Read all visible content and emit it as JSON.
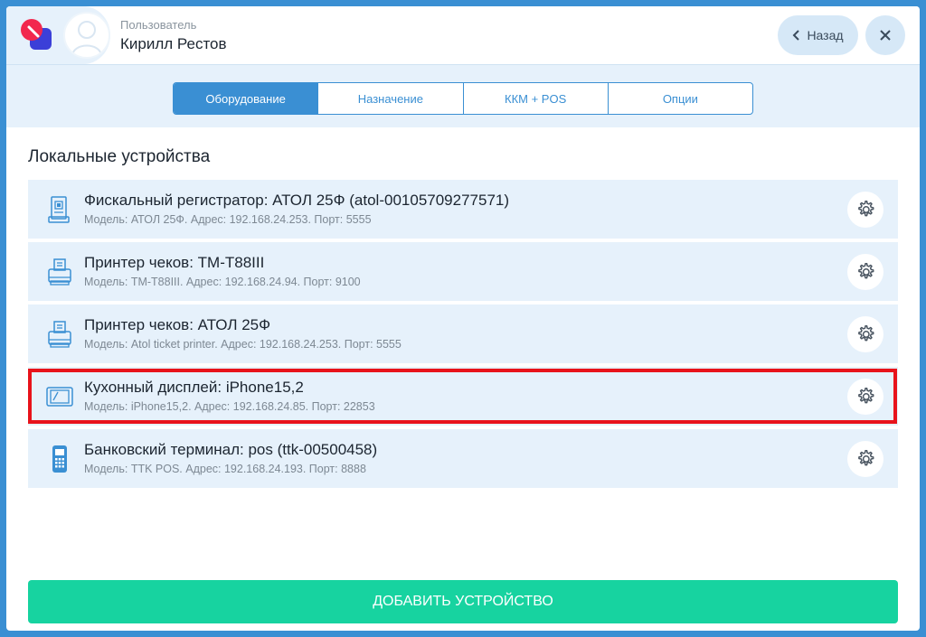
{
  "header": {
    "user_caption": "Пользователь",
    "user_name": "Кирилл Рестов",
    "back_label": "Назад"
  },
  "tabs": [
    {
      "label": "Оборудование",
      "active": true
    },
    {
      "label": "Назначение",
      "active": false
    },
    {
      "label": "ККМ + POS",
      "active": false
    },
    {
      "label": "Опции",
      "active": false
    }
  ],
  "section_title": "Локальные устройства",
  "devices": [
    {
      "icon": "fiscal-register-icon",
      "name": "Фискальный регистратор: АТОЛ 25Ф (atol-00105709277571)",
      "details": "Модель: АТОЛ 25Ф. Адрес: 192.168.24.253. Порт: 5555"
    },
    {
      "icon": "receipt-printer-icon",
      "name": "Принтер чеков: TM-T88III",
      "details": "Модель: TM-T88III. Адрес: 192.168.24.94. Порт: 9100"
    },
    {
      "icon": "receipt-printer-icon",
      "name": "Принтер чеков: АТОЛ 25Ф",
      "details": "Модель: Atol ticket printer. Адрес: 192.168.24.253. Порт: 5555"
    },
    {
      "icon": "tablet-icon",
      "name": "Кухонный дисплей: iPhone15,2",
      "details": "Модель: iPhone15,2. Адрес: 192.168.24.85. Порт: 22853"
    },
    {
      "icon": "card-terminal-icon",
      "name": "Банковский терминал: pos (ttk-00500458)",
      "details": "Модель: TTK POS. Адрес: 192.168.24.193. Порт: 8888"
    }
  ],
  "add_device_label": "ДОБАВИТЬ УСТРОЙСТВО",
  "colors": {
    "accent": "#3a8fd3",
    "row_background": "#e6f1fb",
    "add_button": "#17d3a0",
    "highlight": "#e8131b"
  }
}
